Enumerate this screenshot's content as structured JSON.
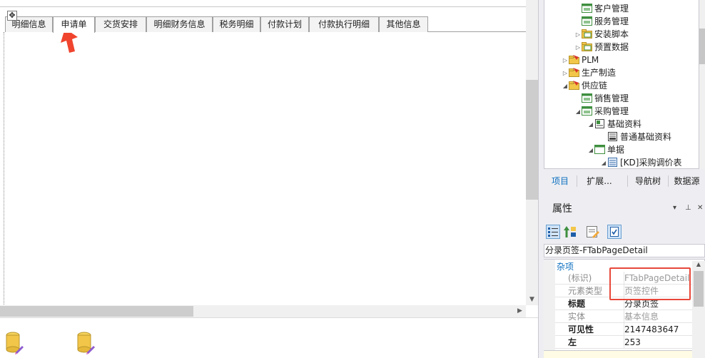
{
  "designer": {
    "move_handle_glyph": "✥",
    "tabs": [
      {
        "label": "明细信息",
        "active": false
      },
      {
        "label": "申请单",
        "active": true
      },
      {
        "label": "交货安排",
        "active": false
      },
      {
        "label": "明细财务信息",
        "active": false
      },
      {
        "label": "税务明细",
        "active": false
      },
      {
        "label": "付款计划",
        "active": false
      },
      {
        "label": "付款执行明细",
        "active": false
      },
      {
        "label": "其他信息",
        "active": false
      }
    ],
    "annotation_arrow_color": "#f0442e",
    "bottom_icons": [
      "database-edit-icon",
      "database-edit-icon"
    ]
  },
  "tree": {
    "items": [
      {
        "label": "客户管理",
        "icon": "form-icon",
        "expander": ""
      },
      {
        "label": "服务管理",
        "icon": "form-icon",
        "expander": ""
      },
      {
        "label": "安装脚本",
        "icon": "script-folder-icon",
        "expander": "▷"
      },
      {
        "label": "预置数据",
        "icon": "script-folder-icon",
        "expander": "▷"
      },
      {
        "label": "PLM",
        "icon": "module-folder-icon",
        "expander": "▷"
      },
      {
        "label": "生产制造",
        "icon": "module-folder-icon",
        "expander": "▷"
      },
      {
        "label": "供应链",
        "icon": "module-folder-icon",
        "expander": "◢"
      },
      {
        "label": "销售管理",
        "icon": "form-icon",
        "expander": ""
      },
      {
        "label": "采购管理",
        "icon": "form-icon",
        "expander": "◢"
      },
      {
        "label": "基础资料",
        "icon": "base-data-icon",
        "expander": "◢"
      },
      {
        "label": "普通基础资料",
        "icon": "base-doc-icon",
        "expander": ""
      },
      {
        "label": "单据",
        "icon": "bill-icon",
        "expander": "◢"
      },
      {
        "label": "[KD]采购调价表",
        "icon": "table-doc-icon",
        "expander": "◢"
      }
    ]
  },
  "panel_tabs": [
    {
      "label": "项目",
      "active": true
    },
    {
      "label": "扩展...",
      "active": false
    },
    {
      "label": "导航树",
      "active": false
    },
    {
      "label": "数据源",
      "active": false
    }
  ],
  "properties": {
    "title": "属性",
    "window_buttons": {
      "dropdown": "▾",
      "pin": "⊥",
      "close": "✕"
    },
    "selected_object": "分录页签-FTabPageDetail",
    "category": "杂项",
    "rows": [
      {
        "name": "(标识)",
        "value": "FTabPageDetail",
        "name_style": "dim",
        "value_style": "dim"
      },
      {
        "name": "元素类型",
        "value": "页签控件",
        "name_style": "dim",
        "value_style": "dim"
      },
      {
        "name": "标题",
        "value": "分录页签",
        "name_style": "bold",
        "value_style": ""
      },
      {
        "name": "实体",
        "value": "基本信息",
        "name_style": "dim",
        "value_style": "dim"
      },
      {
        "name": "可见性",
        "value": "2147483647",
        "name_style": "bold",
        "value_style": ""
      },
      {
        "name": "左",
        "value": "253",
        "name_style": "bold",
        "value_style": ""
      }
    ],
    "highlight_color": "#e8483a"
  },
  "colors": {
    "accent": "#0e70c0",
    "folder_red": "#d9382b",
    "folder_yellow": "#f2c649",
    "form_green": "#3f8f3f"
  }
}
